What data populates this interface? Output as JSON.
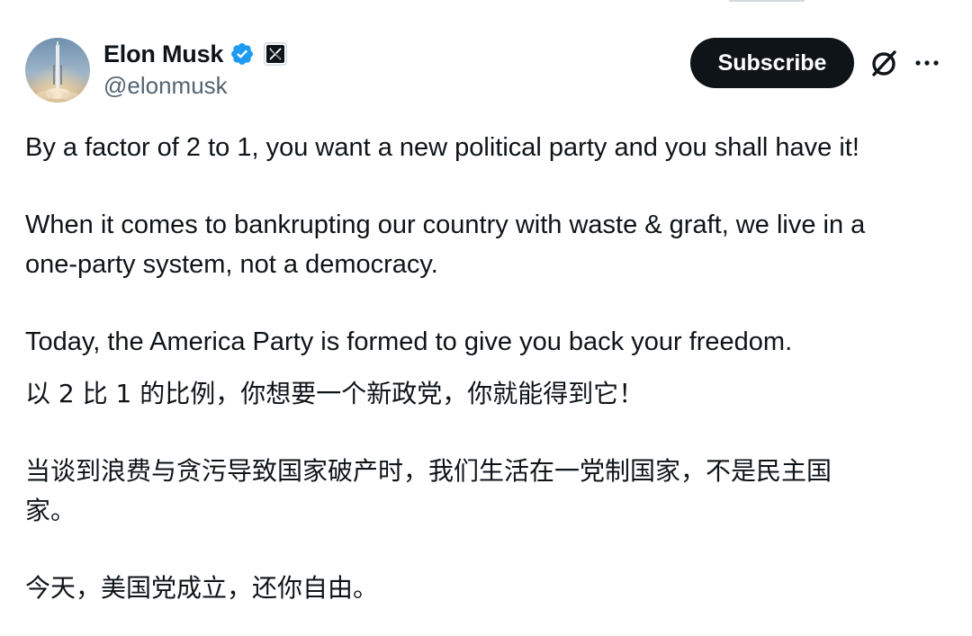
{
  "author": {
    "display_name": "Elon Musk",
    "handle": "@elonmusk"
  },
  "header": {
    "subscribe_label": "Subscribe"
  },
  "icons": {
    "verified": "verified-badge-icon",
    "affiliation": "x-logo-icon",
    "grok": "grok-icon",
    "more": "more-icon"
  },
  "colors": {
    "text": "#0f1419",
    "secondary_text": "#536471",
    "verified_blue": "#1d9bf0",
    "button_bg": "#0f1419",
    "button_text": "#ffffff"
  },
  "tweet": {
    "en": {
      "p1": "By a factor of 2 to 1, you want a new political party and you shall have it!",
      "p2_line1": "When it comes to bankrupting our country with waste & graft, we live in a",
      "p2_line2": "one-party system, not a democracy.",
      "p3": "Today, the America Party is formed to give you back your freedom."
    },
    "zh": {
      "p1": "以 2 比 1 的比例，你想要一个新政党，你就能得到它！",
      "p2_line1": "当谈到浪费与贪污导致国家破产时，我们生活在一党制国家，不是民主国",
      "p2_line2": "家。",
      "p3": "今天，美国党成立，还你自由。"
    }
  }
}
